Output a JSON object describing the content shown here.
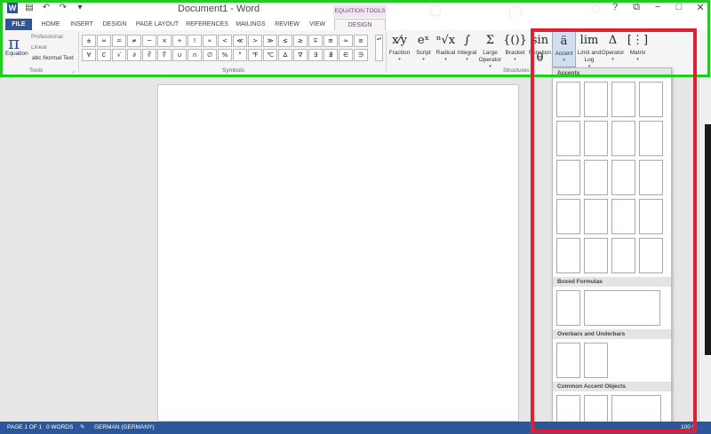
{
  "window": {
    "title": "Document1 - Word"
  },
  "quick_access": {
    "save_icon": "save-icon",
    "undo_icon": "undo-icon",
    "redo_icon": "redo-icon",
    "customize_icon": "customize-qat-icon"
  },
  "window_controls": {
    "help": "?",
    "ribbon_options": "⧉",
    "minimize": "−",
    "maximize": "□",
    "close": "✕"
  },
  "tabs": {
    "context": "EQUATION TOOLS",
    "items": [
      "FILE",
      "HOME",
      "INSERT",
      "DESIGN",
      "PAGE LAYOUT",
      "REFERENCES",
      "MAILINGS",
      "REVIEW",
      "VIEW",
      "DESIGN"
    ]
  },
  "ribbon": {
    "tools": {
      "equation_label": "Equation",
      "professional": "Professional",
      "linear": "Linear",
      "normal_text": "abc Normal Text",
      "group_label": "Tools"
    },
    "symbols": {
      "group_label": "Symbols",
      "row1": [
        "±",
        "∞",
        "=",
        "≠",
        "~",
        "×",
        "÷",
        "!",
        "∝",
        "<",
        "≪",
        ">",
        "≫",
        "≤",
        "≥",
        "∓",
        "≅",
        "≈",
        "≡"
      ],
      "row2": [
        "∀",
        "∁",
        "√",
        "∂",
        "∛",
        "∜",
        "∪",
        "∩",
        "∅",
        "%",
        "°",
        "℉",
        "℃",
        "∆",
        "∇",
        "∃",
        "∄",
        "∈",
        "∋"
      ],
      "more": "▴▾"
    },
    "structures": {
      "group_label": "Structures",
      "items": [
        {
          "glyph": "x⁄y",
          "label": "Fraction"
        },
        {
          "glyph": "eˣ",
          "label": "Script"
        },
        {
          "glyph": "ⁿ√x",
          "label": "Radical"
        },
        {
          "glyph": "∫",
          "label": "Integral"
        },
        {
          "glyph": "Σ",
          "label": "Large Operator"
        },
        {
          "glyph": "{()}",
          "label": "Bracket"
        },
        {
          "glyph": "sin θ",
          "label": "Function"
        },
        {
          "glyph": "ä",
          "label": "Accent"
        },
        {
          "glyph": "lim",
          "label": "Limit and Log"
        },
        {
          "glyph": "Δ",
          "label": "Operator"
        },
        {
          "glyph": "[⋮]",
          "label": "Matrix"
        }
      ]
    }
  },
  "gallery": {
    "sections": [
      {
        "title": "Accents"
      },
      {
        "title": "Boxed Formulas"
      },
      {
        "title": "Overbars and Underbars"
      },
      {
        "title": "Common Accent Objects"
      }
    ]
  },
  "status": {
    "page": "PAGE 1 OF 1",
    "words": "0 WORDS",
    "language": "GERMAN (GERMANY)",
    "zoom": "100 %"
  },
  "colors": {
    "brand": "#2b579a",
    "context_tab": "#7a3f8f",
    "highlight_green": "#22cc22",
    "highlight_red": "#e0202e"
  }
}
